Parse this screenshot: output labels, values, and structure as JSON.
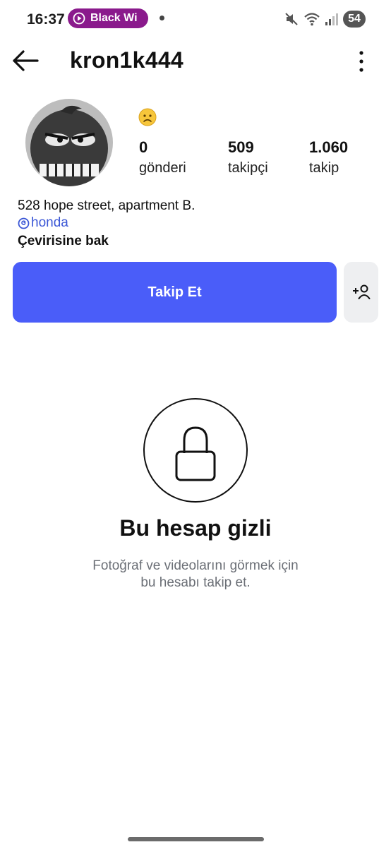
{
  "status_bar": {
    "time": "16:37",
    "media_text": "Black Wi",
    "battery": "54",
    "icons": [
      "media-play-icon",
      "mute-icon",
      "wifi-icon",
      "signal-icon",
      "battery-icon"
    ]
  },
  "header": {
    "username": "kron1k444",
    "icons": [
      "back-arrow-icon",
      "more-vertical-icon"
    ]
  },
  "profile": {
    "emoji": "frowning-face",
    "stats": [
      {
        "value": "0",
        "label": "gönderi"
      },
      {
        "value": "509",
        "label": "takipçi"
      },
      {
        "value": "1.060",
        "label": "takip"
      }
    ],
    "bio_line": "528 hope street, apartment B.",
    "threads_link": "honda",
    "translate": "Çevirisine bak"
  },
  "actions": {
    "follow_label": "Takip Et",
    "follow_color": "#4a5df9"
  },
  "private": {
    "title": "Bu hesap gizli",
    "description_line1": "Fotoğraf ve videolarını görmek için",
    "description_line2": "bu hesabı takip et."
  }
}
